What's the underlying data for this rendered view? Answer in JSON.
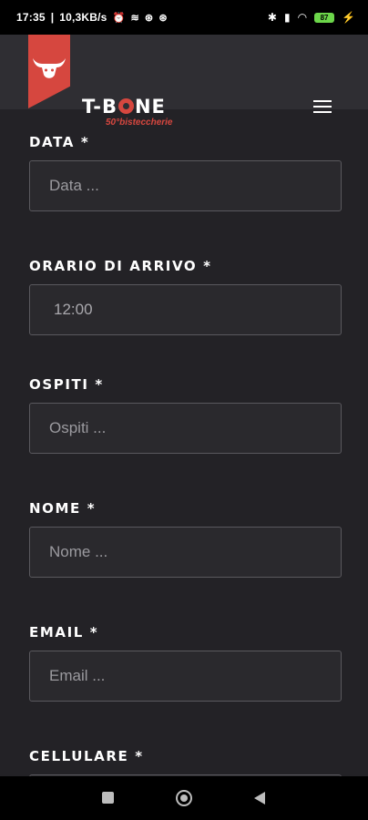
{
  "status_bar": {
    "time": "17:35",
    "network_speed": "10,3KB/s",
    "battery": "87"
  },
  "header": {
    "brand": "T-BONE",
    "subbrand": "50°bisteccherie",
    "brand_color": "#d6473f"
  },
  "form": {
    "fields": [
      {
        "label": "DATA",
        "required": "*",
        "placeholder": "Data ..."
      },
      {
        "label": "ORARIO DI ARRIVO",
        "required": "*",
        "value": "12:00"
      },
      {
        "label": "OSPITI",
        "required": "*",
        "placeholder": "Ospiti ..."
      },
      {
        "label": "NOME",
        "required": "*",
        "placeholder": "Nome ..."
      },
      {
        "label": "EMAIL",
        "required": "*",
        "placeholder": "Email ..."
      },
      {
        "label": "CELLULARE",
        "required": "*",
        "placeholder": ""
      }
    ]
  },
  "icons": {
    "alarm": "alarm-icon",
    "bluetooth": "bluetooth-icon",
    "signal": "signal-icon",
    "wifi": "wifi-icon",
    "battery": "battery-icon",
    "menu": "hamburger-menu-icon"
  }
}
